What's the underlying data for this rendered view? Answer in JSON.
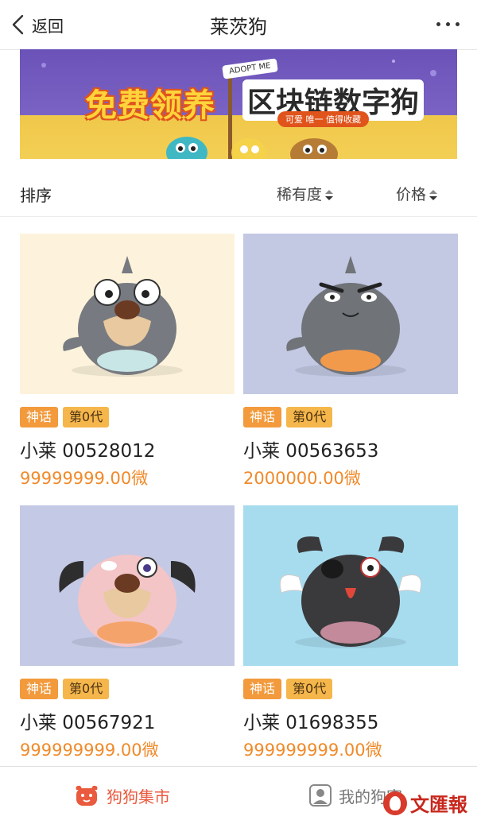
{
  "header": {
    "back_label": "返回",
    "title": "莱茨狗",
    "more_icon": "more-dots-icon"
  },
  "banner": {
    "title_a": "免费领养",
    "title_b": "区块链数字狗",
    "tagline": "可爱  唯一  值得收藏",
    "sign": "ADOPT ME"
  },
  "sortbar": {
    "label": "排序",
    "rarity": "稀有度",
    "price": "价格"
  },
  "cards": [
    {
      "rarity_tag": "神话",
      "generation_tag": "第0代",
      "name": "小莱 00528012",
      "price": "99999999.00微",
      "bg": "#fdf3dc",
      "body": "#777a80",
      "belly": "#c8e6e6"
    },
    {
      "rarity_tag": "神话",
      "generation_tag": "第0代",
      "name": "小莱 00563653",
      "price": "2000000.00微",
      "bg": "#c3c8e3",
      "body": "#707378",
      "belly": "#f29a4c"
    },
    {
      "rarity_tag": "神话",
      "generation_tag": "第0代",
      "name": "小莱 00567921",
      "price": "999999999.00微",
      "bg": "#c4c9e5",
      "body": "#f3c5c7",
      "belly": "#f4a46a"
    },
    {
      "rarity_tag": "神话",
      "generation_tag": "第0代",
      "name": "小莱 01698355",
      "price": "999999999.00微",
      "bg": "#a7dcef",
      "body": "#3a3a3c",
      "belly": "#c28a9b"
    }
  ],
  "bottomnav": {
    "market_label": "狗狗集市",
    "mine_label": "我的狗窝"
  },
  "watermark": "文匯報",
  "colors": {
    "accent": "#f08a2a",
    "tag": "#f29a3c",
    "nav_active": "#ea5a3e"
  }
}
